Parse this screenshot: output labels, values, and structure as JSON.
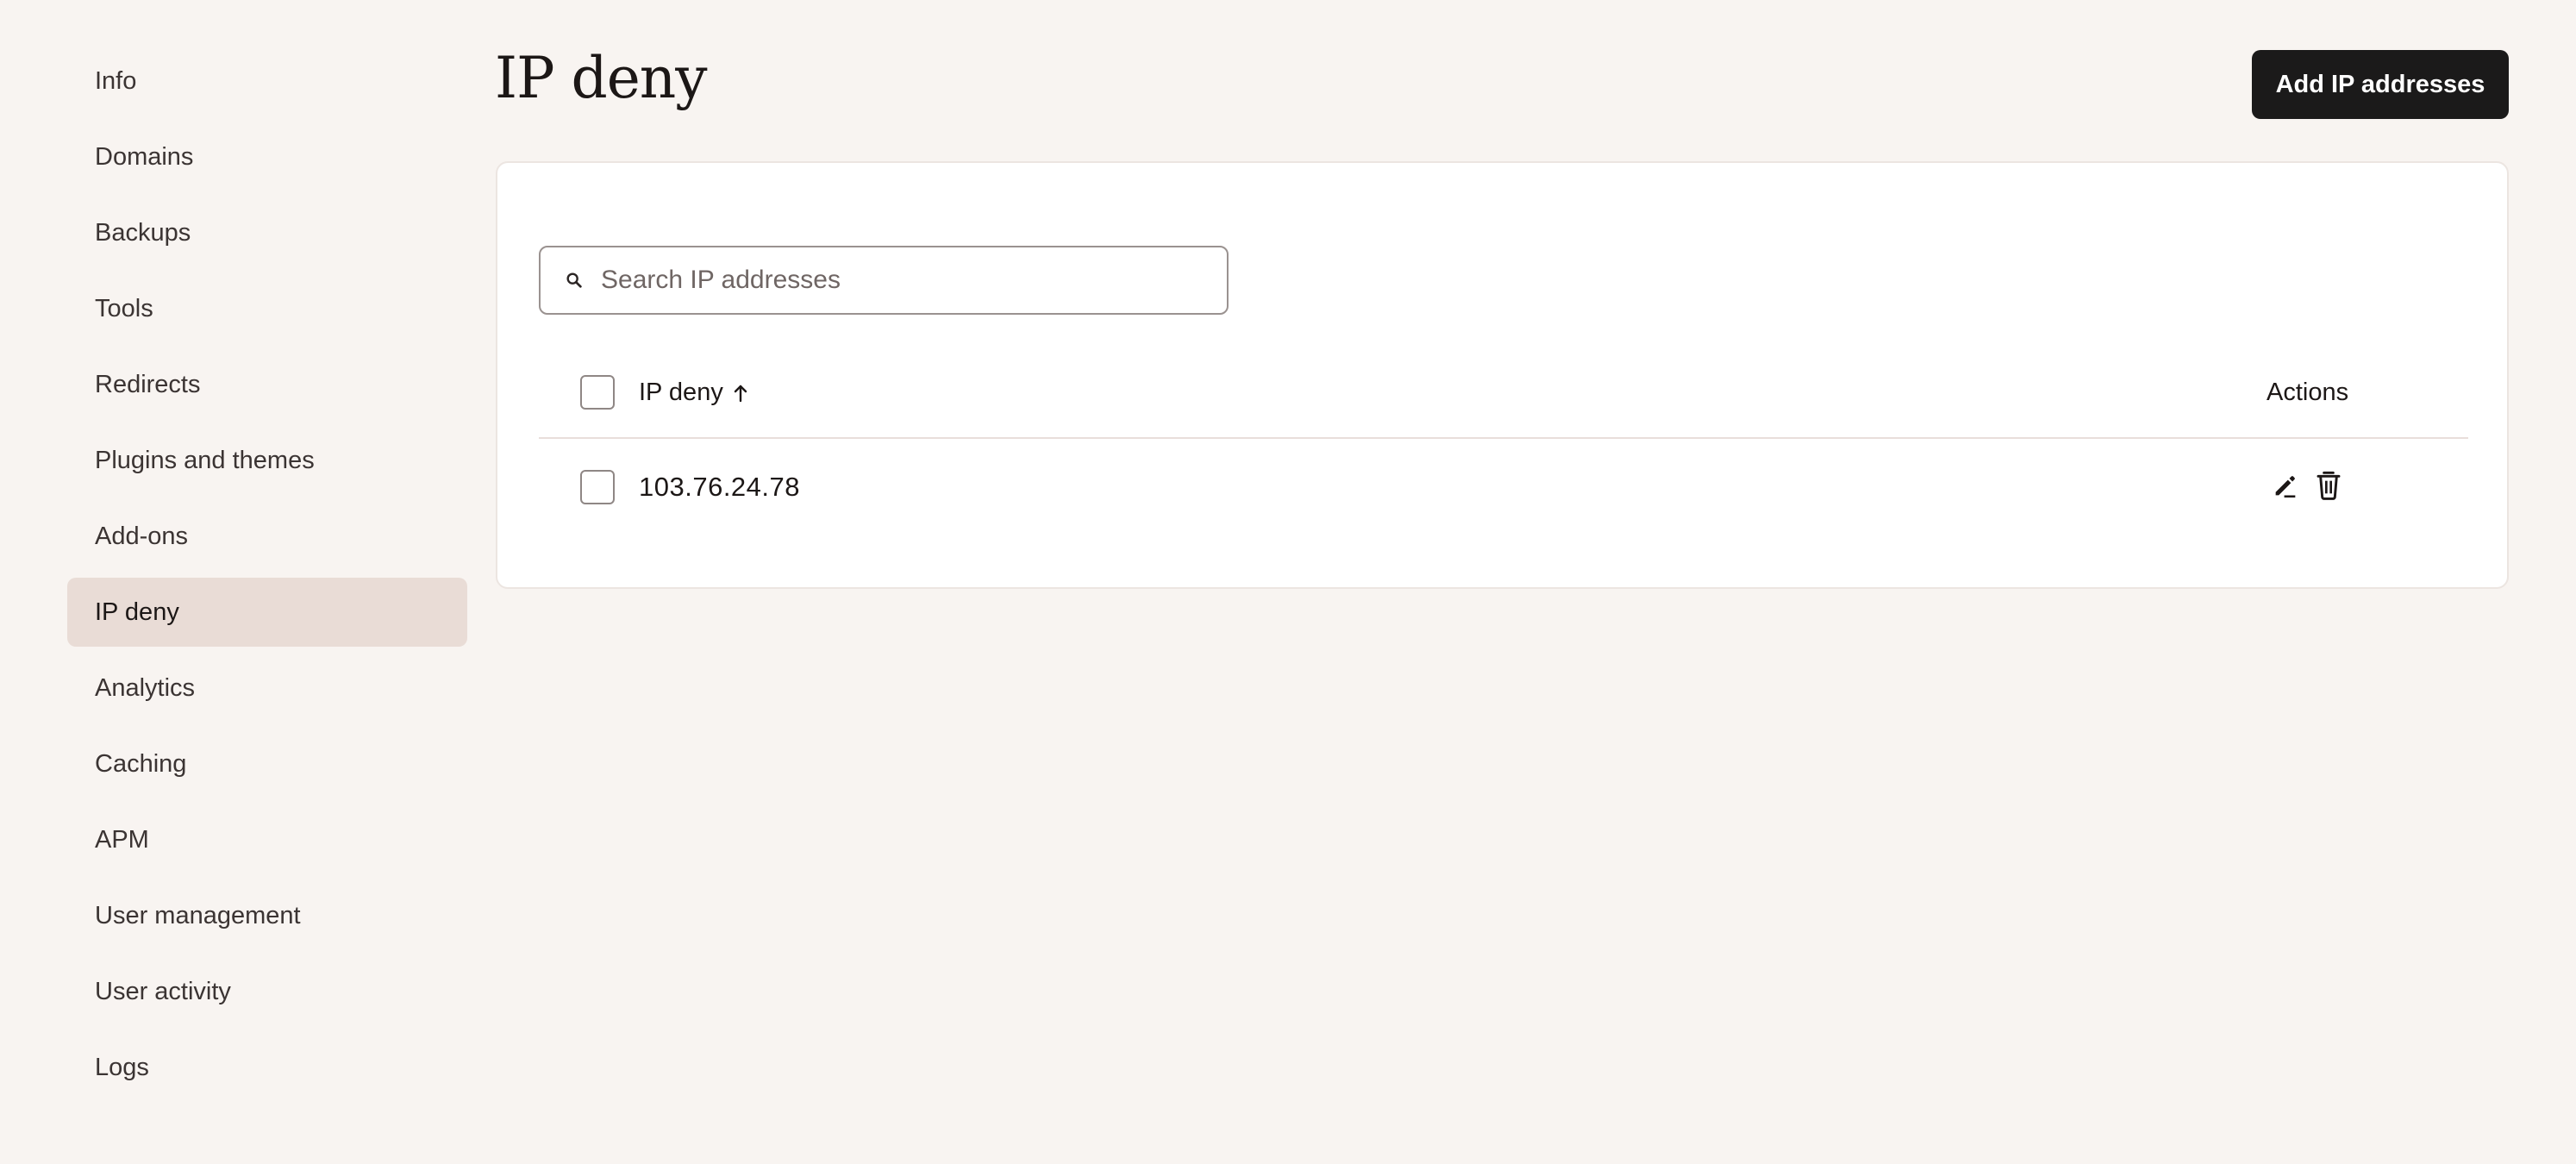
{
  "sidebar": {
    "items": [
      {
        "label": "Info"
      },
      {
        "label": "Domains"
      },
      {
        "label": "Backups"
      },
      {
        "label": "Tools"
      },
      {
        "label": "Redirects"
      },
      {
        "label": "Plugins and themes"
      },
      {
        "label": "Add-ons"
      },
      {
        "label": "IP deny",
        "active": true
      },
      {
        "label": "Analytics"
      },
      {
        "label": "Caching"
      },
      {
        "label": "APM"
      },
      {
        "label": "User management"
      },
      {
        "label": "User activity"
      },
      {
        "label": "Logs"
      }
    ]
  },
  "header": {
    "title": "IP deny",
    "add_button_label": "Add IP addresses"
  },
  "search": {
    "placeholder": "Search IP addresses",
    "value": "",
    "icon": "search-icon"
  },
  "table": {
    "columns": {
      "ip": "IP deny",
      "ip_sort": "ascending",
      "actions": "Actions"
    },
    "rows": [
      {
        "ip": "103.76.24.78",
        "actions": [
          "edit-icon",
          "trash-icon"
        ]
      }
    ]
  },
  "colors": {
    "background": "#f8f4f1",
    "active_item": "#e9dcd6",
    "primary_button": "#1b1a1a",
    "panel": "#ffffff"
  }
}
